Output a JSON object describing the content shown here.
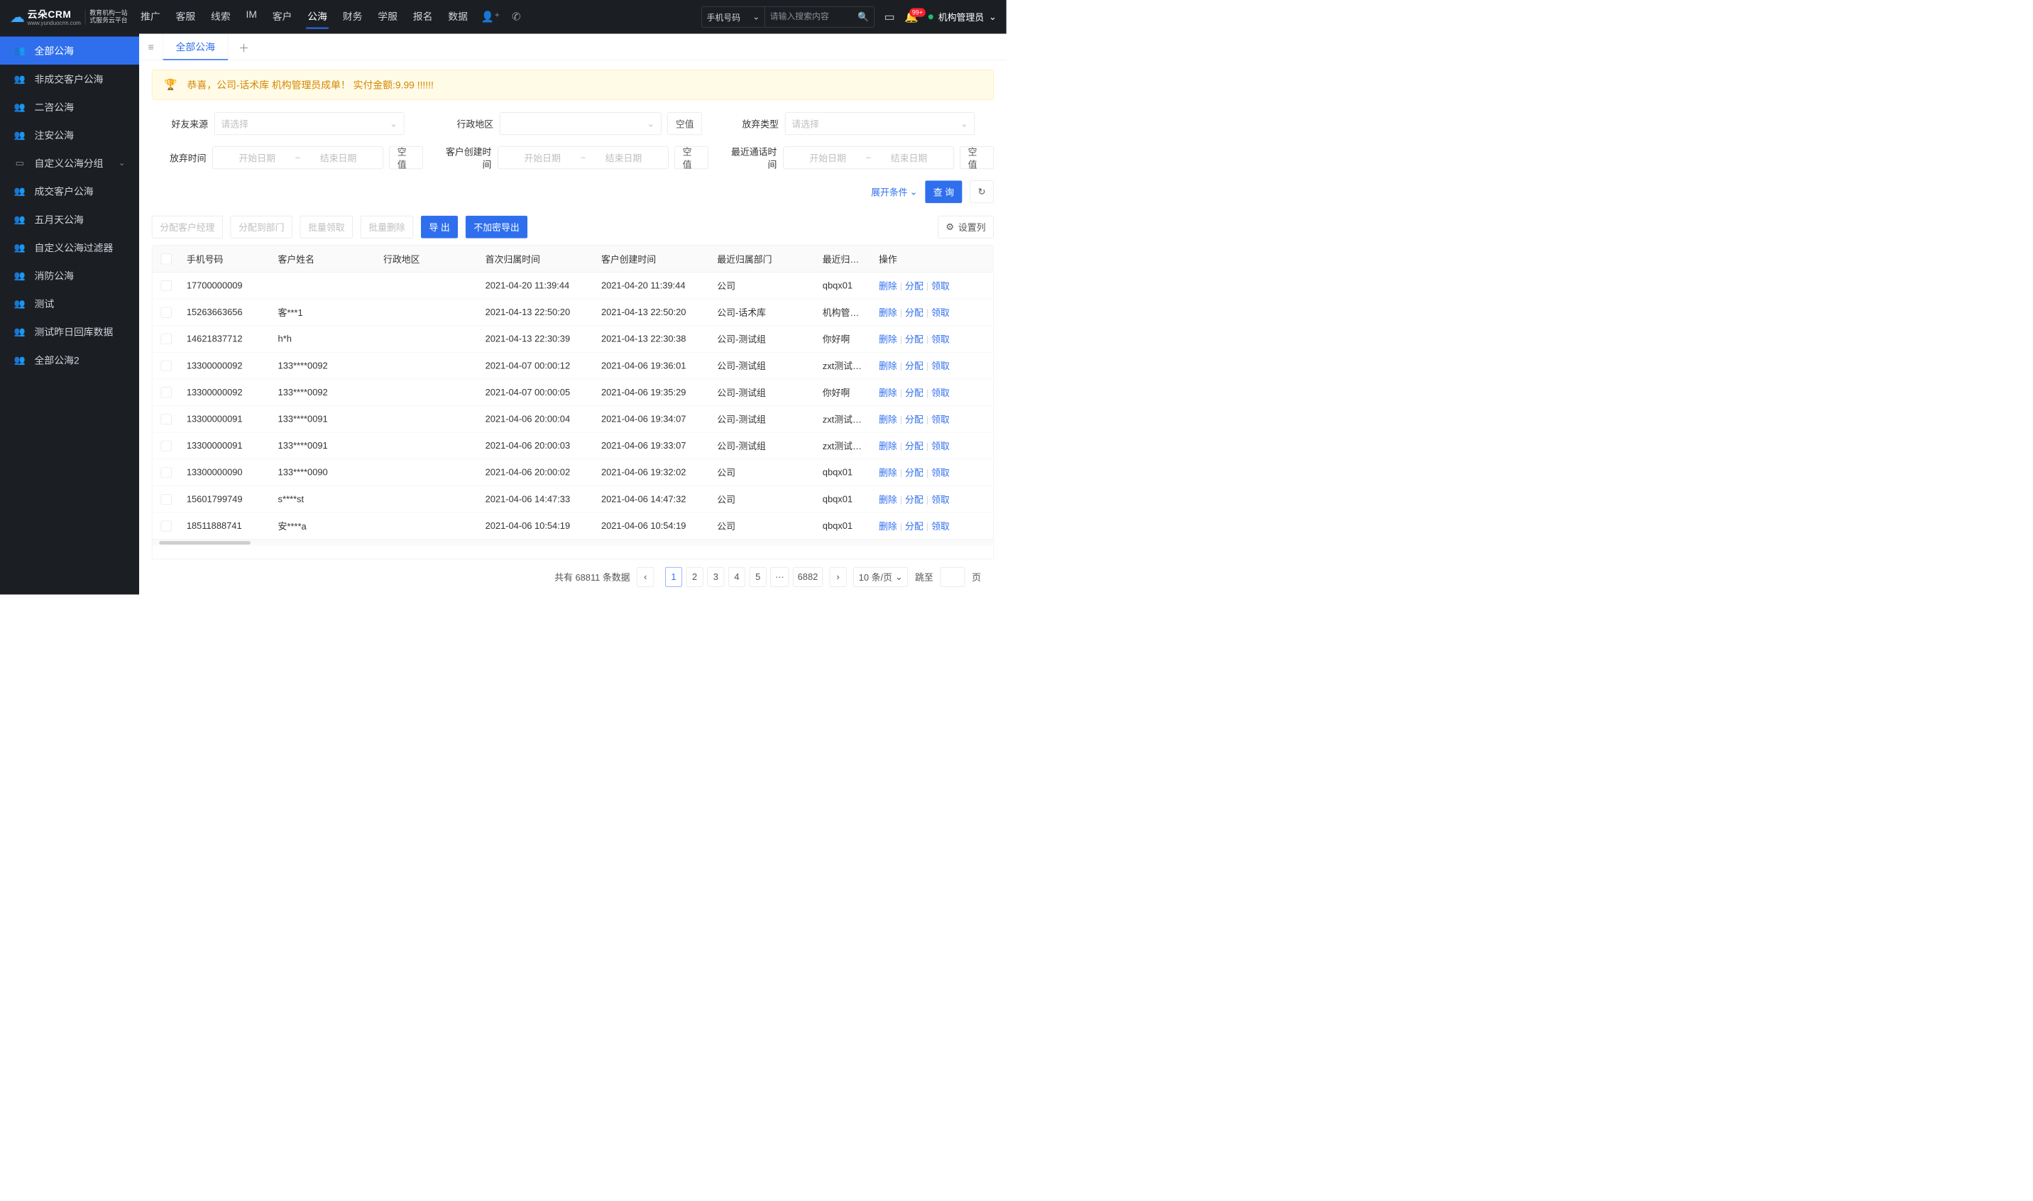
{
  "header": {
    "logo": "云朵CRM",
    "logo_www": "www.yunduocrm.com",
    "logo_sub1": "教育机构一站",
    "logo_sub2": "式服务云平台",
    "nav": [
      "推广",
      "客服",
      "线索",
      "IM",
      "客户",
      "公海",
      "财务",
      "学服",
      "报名",
      "数据"
    ],
    "nav_active": 5,
    "search_type": "手机号码",
    "search_placeholder": "请输入搜索内容",
    "badge": "99+",
    "user": "机构管理员"
  },
  "sidebar": [
    {
      "label": "全部公海",
      "active": true
    },
    {
      "label": "非成交客户公海"
    },
    {
      "label": "二咨公海"
    },
    {
      "label": "注安公海"
    },
    {
      "label": "自定义公海分组",
      "chev": true
    },
    {
      "label": "成交客户公海"
    },
    {
      "label": "五月天公海"
    },
    {
      "label": "自定义公海过滤器"
    },
    {
      "label": "消防公海"
    },
    {
      "label": "测试"
    },
    {
      "label": "测试昨日回库数据"
    },
    {
      "label": "全部公海2"
    }
  ],
  "tab": "全部公海",
  "banner": "恭喜，公司-话术库  机构管理员成单！  实付金额:9.99 !!!!!!",
  "filters": {
    "friend_src_label": "好友来源",
    "friend_src_ph": "请选择",
    "region_label": "行政地区",
    "region_empty": "空值",
    "abandon_type_label": "放弃类型",
    "abandon_type_ph": "请选择",
    "abandon_time_label": "放弃时间",
    "create_time_label": "客户创建时间",
    "last_call_label": "最近通话时间",
    "start_ph": "开始日期",
    "end_ph": "结束日期",
    "empty": "空值",
    "expand": "展开条件",
    "query": "查 询"
  },
  "toolbar": {
    "assign_mgr": "分配客户经理",
    "assign_dept": "分配到部门",
    "batch_claim": "批量领取",
    "batch_del": "批量删除",
    "export": "导 出",
    "export_raw": "不加密导出",
    "set_cols": "设置列"
  },
  "columns": [
    "手机号码",
    "客户姓名",
    "行政地区",
    "首次归属时间",
    "客户创建时间",
    "最近归属部门",
    "最近归属人",
    "操作"
  ],
  "actions": {
    "del": "删除",
    "assign": "分配",
    "claim": "领取"
  },
  "rows": [
    {
      "phone": "17700000009",
      "name": "",
      "region": "",
      "t1": "2021-04-20 11:39:44",
      "t2": "2021-04-20 11:39:44",
      "dept": "公司",
      "own": "qbqx01"
    },
    {
      "phone": "15263663656",
      "name": "客***1",
      "region": "",
      "t1": "2021-04-13 22:50:20",
      "t2": "2021-04-13 22:50:20",
      "dept": "公司-话术库",
      "own": "机构管理员"
    },
    {
      "phone": "14621837712",
      "name": "h*h",
      "region": "",
      "t1": "2021-04-13 22:30:39",
      "t2": "2021-04-13 22:30:38",
      "dept": "公司-测试组",
      "own": "你好啊"
    },
    {
      "phone": "13300000092",
      "name": "133****0092",
      "region": "",
      "t1": "2021-04-07 00:00:12",
      "t2": "2021-04-06 19:36:01",
      "dept": "公司-测试组",
      "own": "zxt测试导入"
    },
    {
      "phone": "13300000092",
      "name": "133****0092",
      "region": "",
      "t1": "2021-04-07 00:00:05",
      "t2": "2021-04-06 19:35:29",
      "dept": "公司-测试组",
      "own": "你好啊"
    },
    {
      "phone": "13300000091",
      "name": "133****0091",
      "region": "",
      "t1": "2021-04-06 20:00:04",
      "t2": "2021-04-06 19:34:07",
      "dept": "公司-测试组",
      "own": "zxt测试导入"
    },
    {
      "phone": "13300000091",
      "name": "133****0091",
      "region": "",
      "t1": "2021-04-06 20:00:03",
      "t2": "2021-04-06 19:33:07",
      "dept": "公司-测试组",
      "own": "zxt测试导入"
    },
    {
      "phone": "13300000090",
      "name": "133****0090",
      "region": "",
      "t1": "2021-04-06 20:00:02",
      "t2": "2021-04-06 19:32:02",
      "dept": "公司",
      "own": "qbqx01"
    },
    {
      "phone": "15601799749",
      "name": "s****st",
      "region": "",
      "t1": "2021-04-06 14:47:33",
      "t2": "2021-04-06 14:47:32",
      "dept": "公司",
      "own": "qbqx01"
    },
    {
      "phone": "18511888741",
      "name": "安****a",
      "region": "",
      "t1": "2021-04-06 10:54:19",
      "t2": "2021-04-06 10:54:19",
      "dept": "公司",
      "own": "qbqx01"
    }
  ],
  "pagination": {
    "total_label": "共有 68811 条数据",
    "pages": [
      "1",
      "2",
      "3",
      "4",
      "5",
      "···",
      "6882"
    ],
    "current": 0,
    "per_page": "10 条/页",
    "jump_label": "跳至",
    "page_suffix": "页"
  }
}
